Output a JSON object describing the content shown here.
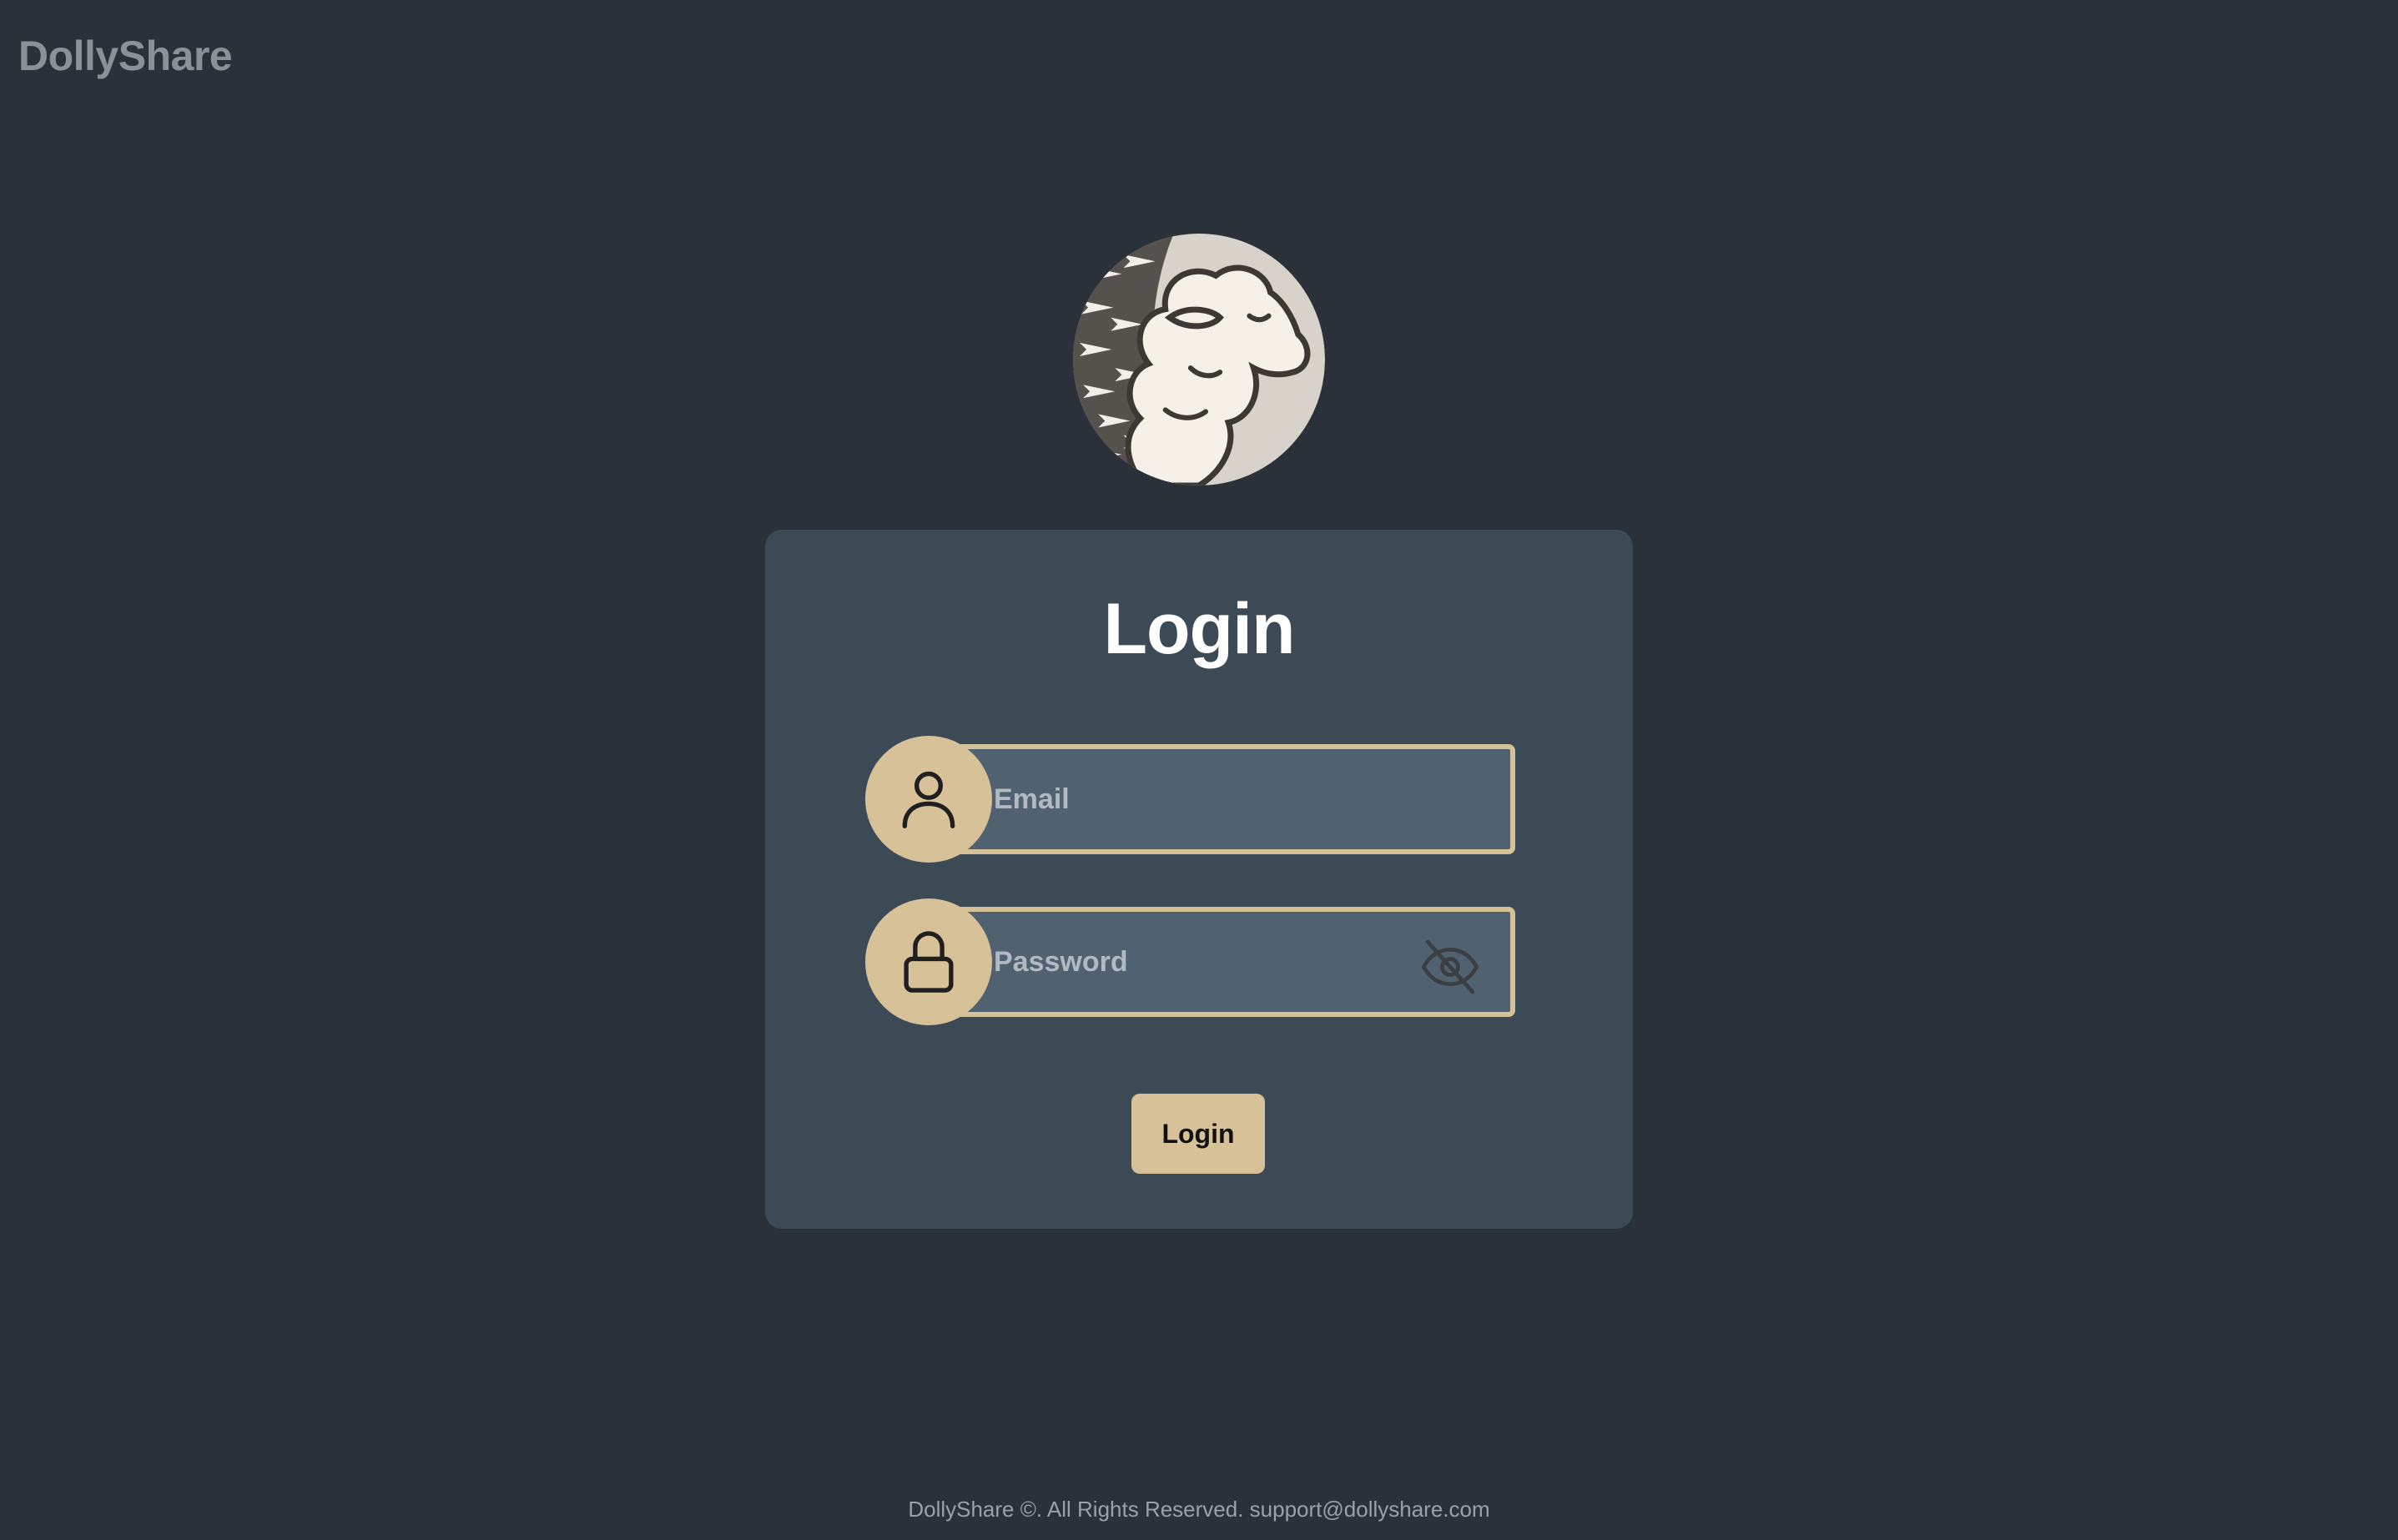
{
  "app": {
    "brand": "DollyShare"
  },
  "login_card": {
    "title": "Login",
    "email_field": {
      "placeholder": "Email",
      "value": "",
      "icon": "user-icon"
    },
    "password_field": {
      "placeholder": "Password",
      "value": "",
      "icon": "lock-icon",
      "toggle_icon": "eye-off-icon"
    },
    "submit_label": "Login"
  },
  "footer": {
    "text": "DollyShare ©. All Rights Reserved. support@dollyshare.com"
  },
  "colors": {
    "background": "#2a3139",
    "card": "#3c4a55",
    "input": "#506270",
    "accent": "#d6c198",
    "brand_text": "#8c9196"
  }
}
